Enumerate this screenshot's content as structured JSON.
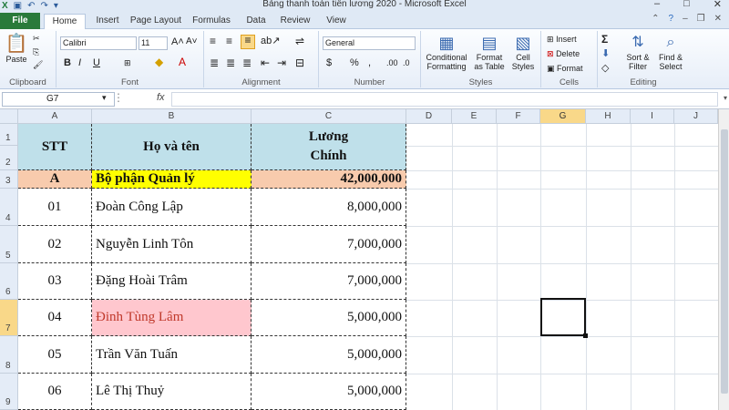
{
  "window": {
    "title": "Bảng thanh toán tiền lương 2020  -  Microsoft Excel"
  },
  "tabs": [
    "File",
    "Home",
    "Insert",
    "Page Layout",
    "Formulas",
    "Data",
    "Review",
    "View"
  ],
  "ribbon": {
    "clipboard": {
      "label": "Clipboard",
      "paste": "Paste"
    },
    "font": {
      "label": "Font",
      "name": "Calibri",
      "size": "11",
      "bold": "B",
      "italic": "I",
      "underline": "U"
    },
    "alignment": {
      "label": "Alignment"
    },
    "number": {
      "label": "Number",
      "format": "General",
      "currency": "$",
      "percent": "%",
      "comma": ","
    },
    "styles": {
      "label": "Styles",
      "conditional": "Conditional Formatting",
      "format_table": "Format as Table",
      "cell_styles": "Cell Styles"
    },
    "cells": {
      "label": "Cells",
      "insert": "Insert",
      "delete": "Delete",
      "format": "Format"
    },
    "editing": {
      "label": "Editing",
      "sort": "Sort & Filter",
      "find": "Find & Select"
    }
  },
  "formula_bar": {
    "name_box": "G7",
    "fx": "fx",
    "content": ""
  },
  "columns": [
    "A",
    "B",
    "C",
    "D",
    "E",
    "F",
    "G",
    "H",
    "I",
    "J"
  ],
  "rows": [
    "1",
    "2",
    "3",
    "4",
    "5",
    "6",
    "7",
    "8",
    "9"
  ],
  "sheet": {
    "header": {
      "stt": "STT",
      "name": "Họ và tên",
      "salary_line1": "Lương",
      "salary_line2": "Chính"
    },
    "group": {
      "code": "A",
      "name": "Bộ phận Quản lý",
      "salary": "42,000,000"
    },
    "records": [
      {
        "stt": "01",
        "name": "Đoàn Công Lập",
        "salary": "8,000,000"
      },
      {
        "stt": "02",
        "name": "Nguyễn Linh Tôn",
        "salary": "7,000,000"
      },
      {
        "stt": "03",
        "name": "Đặng Hoài Trâm",
        "salary": "7,000,000"
      },
      {
        "stt": "04",
        "name": "Đinh Tùng Lâm",
        "salary": "5,000,000"
      },
      {
        "stt": "05",
        "name": "Trần Văn Tuấn",
        "salary": "5,000,000"
      },
      {
        "stt": "06",
        "name": "Lê Thị Thuỷ",
        "salary": "5,000,000"
      }
    ]
  },
  "colors": {
    "header_fill": "#bfe0ea",
    "group_code_fill": "#f8cbad",
    "group_name_fill": "#ffff00",
    "highlight_fill": "#ffc7ce",
    "highlight_text": "#c0392b",
    "file_tab": "#2a7a3a"
  }
}
